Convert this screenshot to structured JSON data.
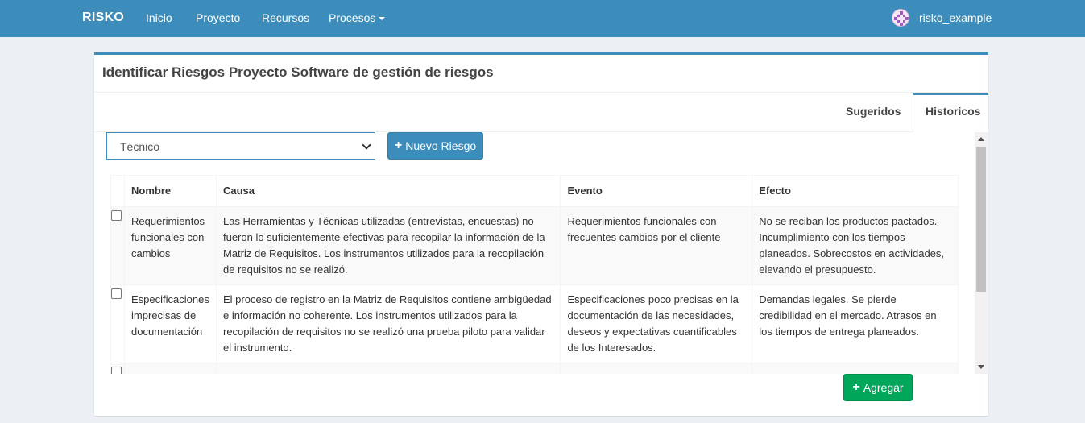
{
  "navbar": {
    "brand": "RISKO",
    "items": [
      {
        "label": "Inicio"
      },
      {
        "label": "Proyecto"
      },
      {
        "label": "Recursos"
      },
      {
        "label": "Procesos"
      }
    ],
    "username": "risko_example"
  },
  "box": {
    "title": "Identificar Riesgos Proyecto Software de gestión de riesgos",
    "tabs": [
      {
        "label": "Sugeridos",
        "active": false
      },
      {
        "label": "Historicos",
        "active": true
      }
    ]
  },
  "controls": {
    "category_select": {
      "selected": "Técnico"
    },
    "new_risk_button": "Nuevo Riesgo",
    "add_button": "Agregar"
  },
  "table": {
    "headers": [
      "Nombre",
      "Causa",
      "Evento",
      "Efecto"
    ],
    "rows": [
      {
        "nombre": "Requerimientos funcionales con cambios",
        "causa": "Las Herramientas y Técnicas utilizadas (entrevistas, encuestas) no fueron lo suficientemente efectivas para recopilar la información de la Matriz de Requisitos. Los instrumentos utilizados para la recopilación de requisitos no se realizó.",
        "evento": "Requerimientos funcionales con frecuentes cambios por el cliente",
        "efecto": "No se reciban los productos pactados. Incumplimiento con los tiempos planeados. Sobrecostos en actividades, elevando el presupuesto."
      },
      {
        "nombre": "Especificaciones imprecisas de documentación",
        "causa": "El proceso de registro en la Matriz de Requisitos contiene ambigüedad e información no coherente. Los instrumentos utilizados para la recopilación de requisitos no se realizó una prueba piloto para validar el instrumento.",
        "evento": "Especificaciones poco precisas en la documentación de las necesidades, deseos y expectativas cuantificables de los Interesados.",
        "efecto": "Demandas legales. Se pierde credibilidad en el mercado. Atrasos en los tiempos de entrega planeados."
      }
    ]
  },
  "colors": {
    "primary": "#3c8dbc",
    "success": "#00a65a",
    "background": "#ecf0f5"
  }
}
